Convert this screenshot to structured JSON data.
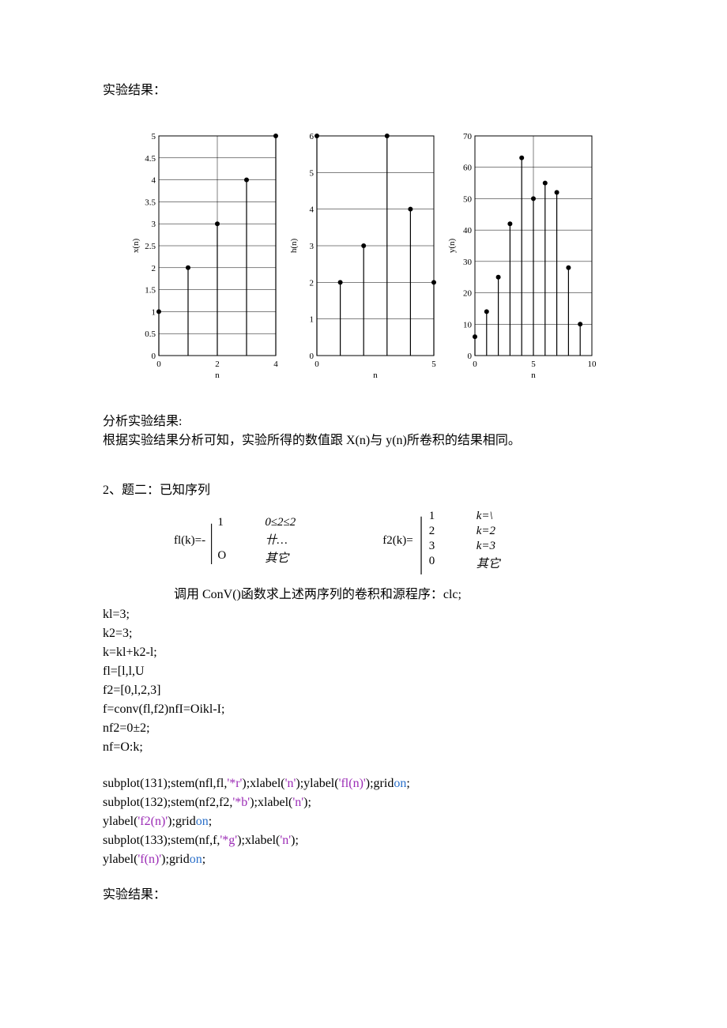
{
  "heading1": "实验结果：",
  "analysis_title": "分析实验结果:",
  "analysis_body": "根据实验结果分析可知，实验所得的数值跟 X(n)与 y(n)所卷积的结果相同。",
  "section2_title": "2、题二：已知序列",
  "f1_label": "fl(k)=-",
  "f1_cases": [
    {
      "v": "1",
      "c": "0≤2≤2"
    },
    {
      "v": "",
      "c": "卄…"
    },
    {
      "v": "O",
      "c": "其它"
    }
  ],
  "f2_label": "f2(k)=",
  "f2_cases": [
    {
      "v": "1",
      "c": "k=\\"
    },
    {
      "v": "2",
      "c": "k=2"
    },
    {
      "v": "3",
      "c": "k=3"
    },
    {
      "v": "0",
      "c": "其它"
    }
  ],
  "call_text": "调用 ConV()函数求上述两序列的卷积和源程序：clc;",
  "code_lines": [
    "kl=3;",
    "k2=3;",
    "k=kl+k2-l;",
    "fl=[l,l,U",
    "f2=[0,l,2,3]",
    "f=conv(fl,f2)nfI=Oikl-I;",
    "nf2=0±2;",
    "nf=O:k;"
  ],
  "plot_lines": [
    {
      "pre": "subplot(131);stem(nfl,fl,",
      "str": "'*r'",
      "mid": ");xlabel(",
      "str2": "'n'",
      "mid2": ");ylabel(",
      "str3": "'fl(n)'",
      "post": ");grid",
      "on": "on",
      "end": ";"
    },
    {
      "pre": "subplot(132);stem(nf2,f2,",
      "str": "'*b'",
      "mid": ");xlabel(",
      "str2": "'n'",
      "post": ");",
      "newline_ylabel": true,
      "yl_pre": "ylabel(",
      "yl_str": "'f2(n)'",
      "yl_post": ");grid",
      "yl_on": "on",
      "yl_end": ";"
    },
    {
      "pre": "subplot(133);stem(nf,f,",
      "str": "'*g'",
      "mid": ");xlabel(",
      "str2": "'n'",
      "post": ");",
      "newline_ylabel": true,
      "yl_pre": "ylabel(",
      "yl_str": "'f(n)'",
      "yl_post": ");grid",
      "yl_on": "on",
      "yl_end": ";"
    }
  ],
  "heading2": "实验结果：",
  "chart_data": [
    {
      "type": "stem",
      "ylabel": "x(n)",
      "xlabel": "n",
      "xlim": [
        0,
        4
      ],
      "ylim": [
        0,
        5
      ],
      "xticks": [
        0,
        2,
        4
      ],
      "yticks": [
        0,
        0.5,
        1,
        1.5,
        2,
        2.5,
        3,
        3.5,
        4,
        4.5,
        5
      ],
      "values": [
        [
          0,
          1
        ],
        [
          1,
          2
        ],
        [
          2,
          3
        ],
        [
          3,
          4
        ],
        [
          4,
          5
        ]
      ]
    },
    {
      "type": "stem",
      "ylabel": "h(n)",
      "xlabel": "n",
      "xlim": [
        0,
        5
      ],
      "ylim": [
        0,
        6
      ],
      "xticks": [
        0,
        5
      ],
      "yticks": [
        0,
        1,
        2,
        3,
        4,
        5,
        6
      ],
      "values": [
        [
          0,
          6
        ],
        [
          1,
          2
        ],
        [
          2,
          3
        ],
        [
          3,
          6
        ],
        [
          4,
          4
        ],
        [
          5,
          2
        ]
      ]
    },
    {
      "type": "stem",
      "ylabel": "y(n)",
      "xlabel": "n",
      "xlim": [
        0,
        10
      ],
      "ylim": [
        0,
        70
      ],
      "xticks": [
        0,
        5,
        10
      ],
      "yticks": [
        0,
        10,
        20,
        30,
        40,
        50,
        60,
        70
      ],
      "values": [
        [
          0,
          6
        ],
        [
          1,
          14
        ],
        [
          2,
          25
        ],
        [
          3,
          42
        ],
        [
          4,
          63
        ],
        [
          5,
          50
        ],
        [
          6,
          55
        ],
        [
          7,
          52
        ],
        [
          8,
          28
        ],
        [
          9,
          10
        ]
      ]
    }
  ]
}
